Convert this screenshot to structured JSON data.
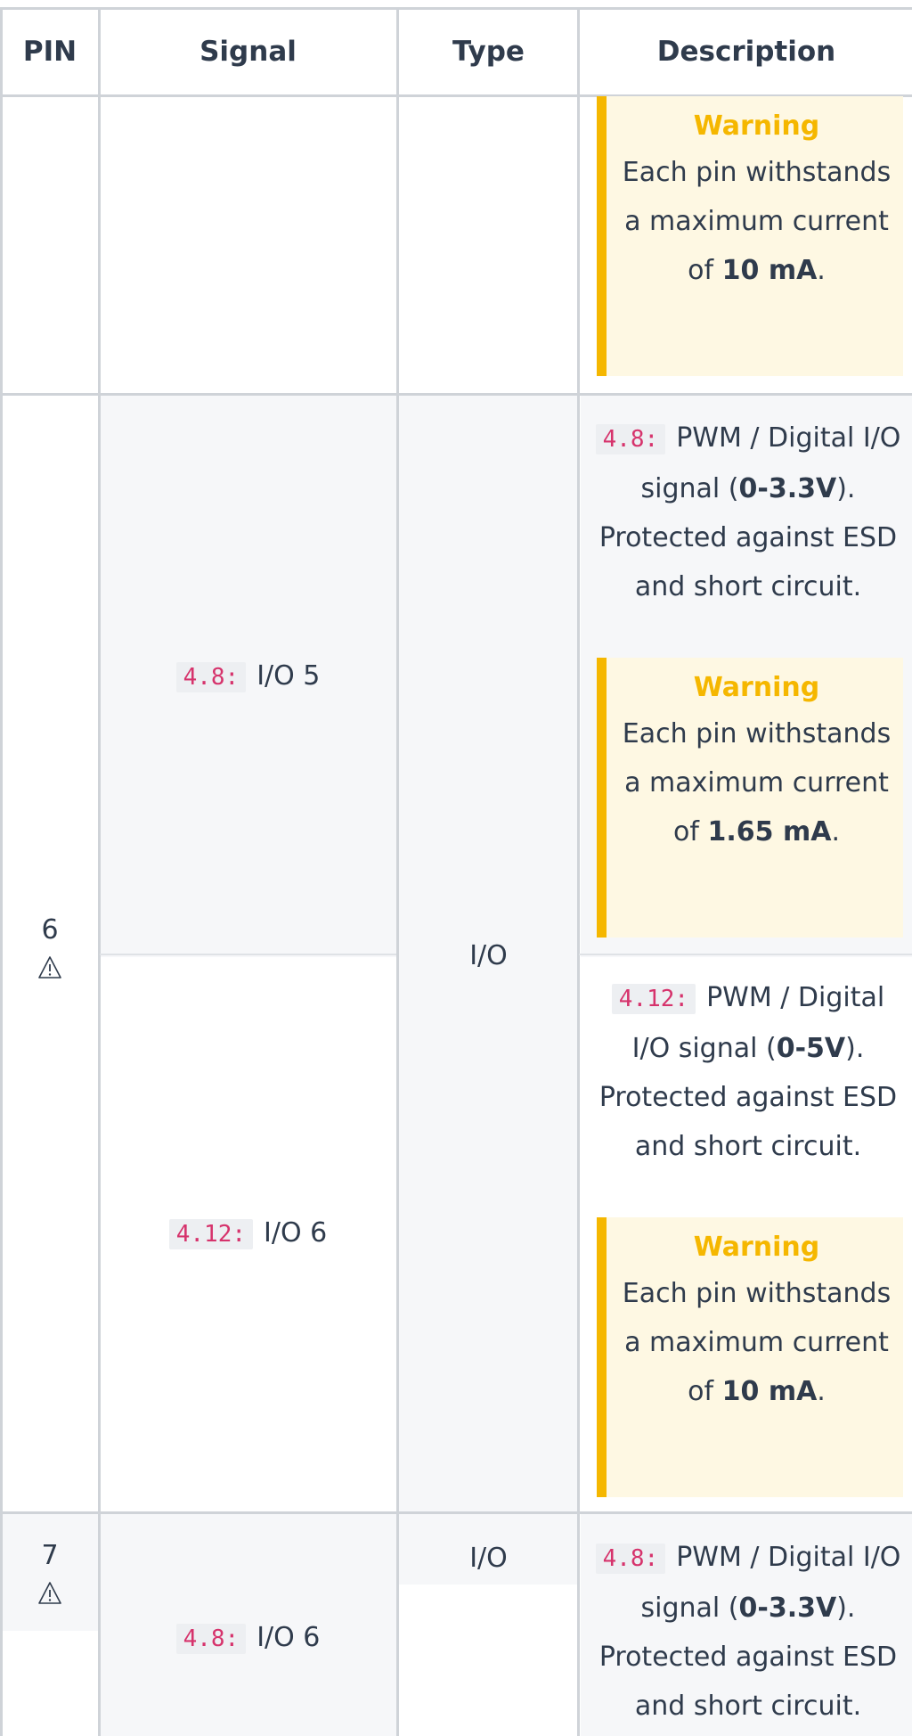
{
  "table": {
    "headers": {
      "pin": "PIN",
      "signal": "Signal",
      "type": "Type",
      "description": "Description"
    },
    "continuation_warning": {
      "title": "Warning",
      "text": "Each pin withstands a maximum current of",
      "value": "10 mA",
      "suffix": "."
    },
    "row6": {
      "pin": "6",
      "type": "I/O",
      "variants": [
        {
          "version": "4.8:",
          "signal": "I/O 5",
          "desc_prefix": "PWM / Digital I/O signal (",
          "desc_voltage": "0-3.3V",
          "desc_suffix": "). Protected against ESD and short circuit.",
          "warning": {
            "title": "Warning",
            "text": "Each pin withstands a maximum current of",
            "value": "1.65 mA",
            "suffix": "."
          }
        },
        {
          "version": "4.12:",
          "signal": "I/O 6",
          "desc_prefix": "PWM / Digital I/O signal (",
          "desc_voltage": "0-5V",
          "desc_suffix": "). Protected against ESD and short circuit.",
          "warning": {
            "title": "Warning",
            "text": "Each pin withstands a maximum current of",
            "value": "10 mA",
            "suffix": "."
          }
        }
      ]
    },
    "row7": {
      "pin": "7",
      "type": "I/O",
      "version": "4.8:",
      "signal": "I/O 6",
      "desc_prefix": "PWM / Digital I/O signal (",
      "desc_voltage": "0-3.3V",
      "desc_suffix": "). Protected against ESD and short circuit."
    }
  },
  "icons": {
    "pin_warning": "warning-triangle-icon"
  },
  "colors": {
    "warning_accent": "#f5b700",
    "warning_bg": "#fef8e3",
    "code_text": "#d6336c"
  }
}
